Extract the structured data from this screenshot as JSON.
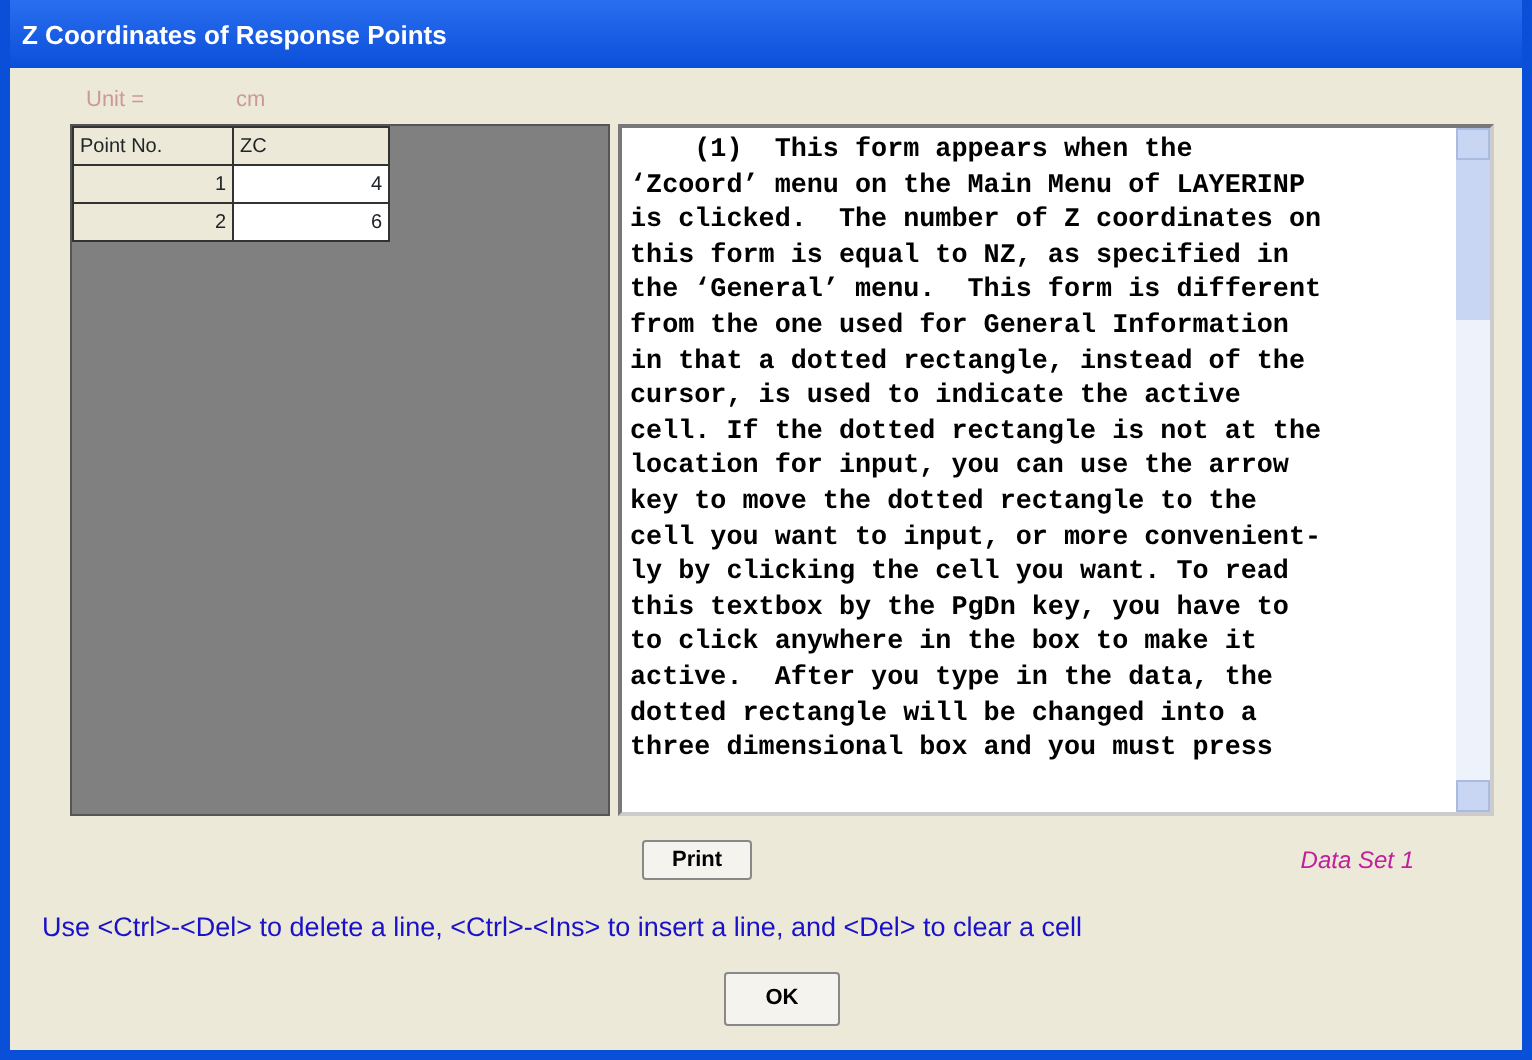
{
  "window": {
    "title": "Z Coordinates of Response Points"
  },
  "units": [
    "Unit =",
    "cm"
  ],
  "table": {
    "columns": [
      "Point No.",
      "ZC"
    ],
    "rows": [
      {
        "point": "1",
        "zc": "4"
      },
      {
        "point": "2",
        "zc": "6"
      }
    ]
  },
  "help_text": [
    "    (1)  This form appears when the",
    "‘Zcoord’ menu on the Main Menu of LAYERINP",
    "is clicked.  The number of Z coordinates on",
    "this form is equal to NZ, as specified in",
    "the ‘General’ menu.  This form is different",
    "from the one used for General Information",
    "in that a dotted rectangle, instead of the",
    "cursor, is used to indicate the active",
    "cell. If the dotted rectangle is not at the",
    "location for input, you can use the arrow",
    "key to move the dotted rectangle to the",
    "cell you want to input, or more convenient-",
    "ly by clicking the cell you want. To read",
    "this textbox by the PgDn key, you have to",
    "to click anywhere in the box to make it",
    "active.  After you type in the data, the",
    "dotted rectangle will be changed into a",
    "three dimensional box and you must press"
  ],
  "print_button": "Print",
  "data_set": "Data Set 1",
  "instruction": "Use <Ctrl>-<Del> to delete a line, <Ctrl>-<Ins> to insert a line, and <Del> to clear a cell",
  "ok_button": "OK"
}
